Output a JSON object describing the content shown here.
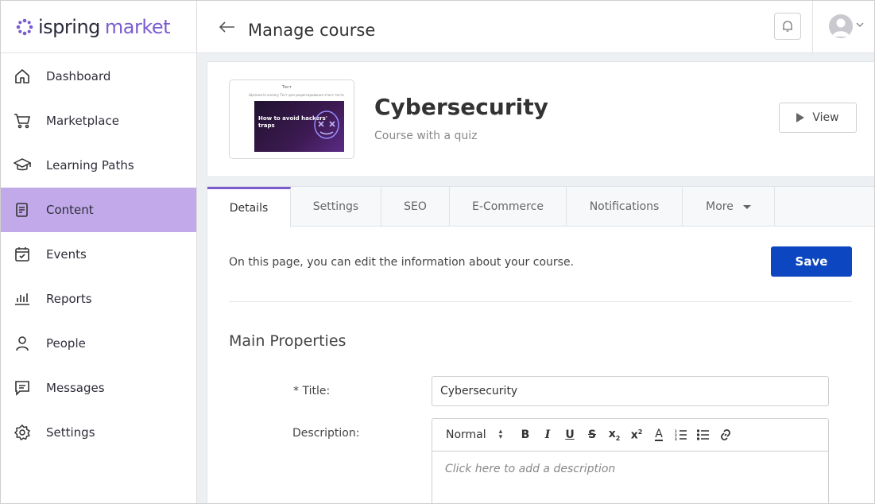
{
  "brand": {
    "name_part1": "ispring",
    "name_part2": "market",
    "accent": "#7b5ccf"
  },
  "sidebar": {
    "items": [
      {
        "label": "Dashboard",
        "icon": "home-icon"
      },
      {
        "label": "Marketplace",
        "icon": "cart-icon"
      },
      {
        "label": "Learning Paths",
        "icon": "graduation-cap-icon"
      },
      {
        "label": "Content",
        "icon": "content-icon",
        "active": true
      },
      {
        "label": "Events",
        "icon": "calendar-check-icon"
      },
      {
        "label": "Reports",
        "icon": "bar-chart-icon"
      },
      {
        "label": "People",
        "icon": "person-icon"
      },
      {
        "label": "Messages",
        "icon": "message-icon"
      },
      {
        "label": "Settings",
        "icon": "gear-icon"
      }
    ],
    "active_color": "#c1a9ea"
  },
  "header": {
    "title": "Manage course"
  },
  "course": {
    "title": "Cybersecurity",
    "subtitle": "Course with a quiz",
    "view_label": "View",
    "thumbnail": {
      "top_text": "Тест",
      "caption": "Щелкните кнопку Тест для редактирования этого теста",
      "image_title": "How to avoid hackers' traps"
    }
  },
  "tabs": [
    {
      "label": "Details",
      "active": true
    },
    {
      "label": "Settings"
    },
    {
      "label": "SEO"
    },
    {
      "label": "E-Commerce"
    },
    {
      "label": "Notifications"
    },
    {
      "label": "More"
    }
  ],
  "details": {
    "intro": "On this page, you can edit the information about your course.",
    "save_label": "Save",
    "section_title": "Main Properties",
    "title_label": "* Title:",
    "title_value": "Cybersecurity",
    "description_label": "Description:",
    "description_placeholder": "Click here to add a description",
    "editor_format": "Normal",
    "primary_color": "#0c46c0"
  }
}
